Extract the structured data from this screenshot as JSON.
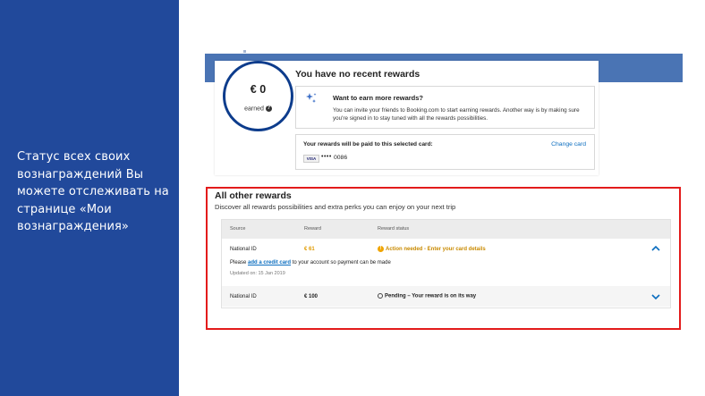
{
  "slide": {
    "caption": "Статус всех своих вознаграждений Вы можете отслеживать на странице «Мои вознаграждения»"
  },
  "summary": {
    "amount": "€ 0",
    "earned_label": "earned",
    "title": "You have no recent rewards"
  },
  "earn_more": {
    "title": "Want to earn more rewards?",
    "text": "You can invite your friends to Booking.com to start earning rewards. Another way is by making sure you're signed in to stay tuned with all the rewards possibilities."
  },
  "payout_card": {
    "title": "Your rewards will be paid to this selected card:",
    "change_label": "Change card",
    "brand": "VISA",
    "masked": "••••",
    "last_digits": "0086"
  },
  "other_rewards": {
    "title": "All other rewards",
    "subtitle": "Discover all rewards possibilities and extra perks you can enjoy on your next trip",
    "columns": [
      "Source",
      "Reward",
      "Reward status"
    ],
    "rows": [
      {
        "source": "National ID",
        "reward": "€ 61",
        "status": "Action needed - Enter your card details",
        "detail_prefix": "Please",
        "detail_link": "add a credit card",
        "detail_suffix": "to your account so payment can be made",
        "updated": "Updated on: 15 Jan 2019"
      },
      {
        "source": "National ID",
        "reward": "€ 100",
        "status": "Pending – Your reward is on its way"
      }
    ]
  },
  "colors": {
    "panel": "#21499b",
    "band": "#4a74b4",
    "frame": "#e31b1b",
    "link": "#0a6dbf",
    "amber": "#e09a00"
  }
}
